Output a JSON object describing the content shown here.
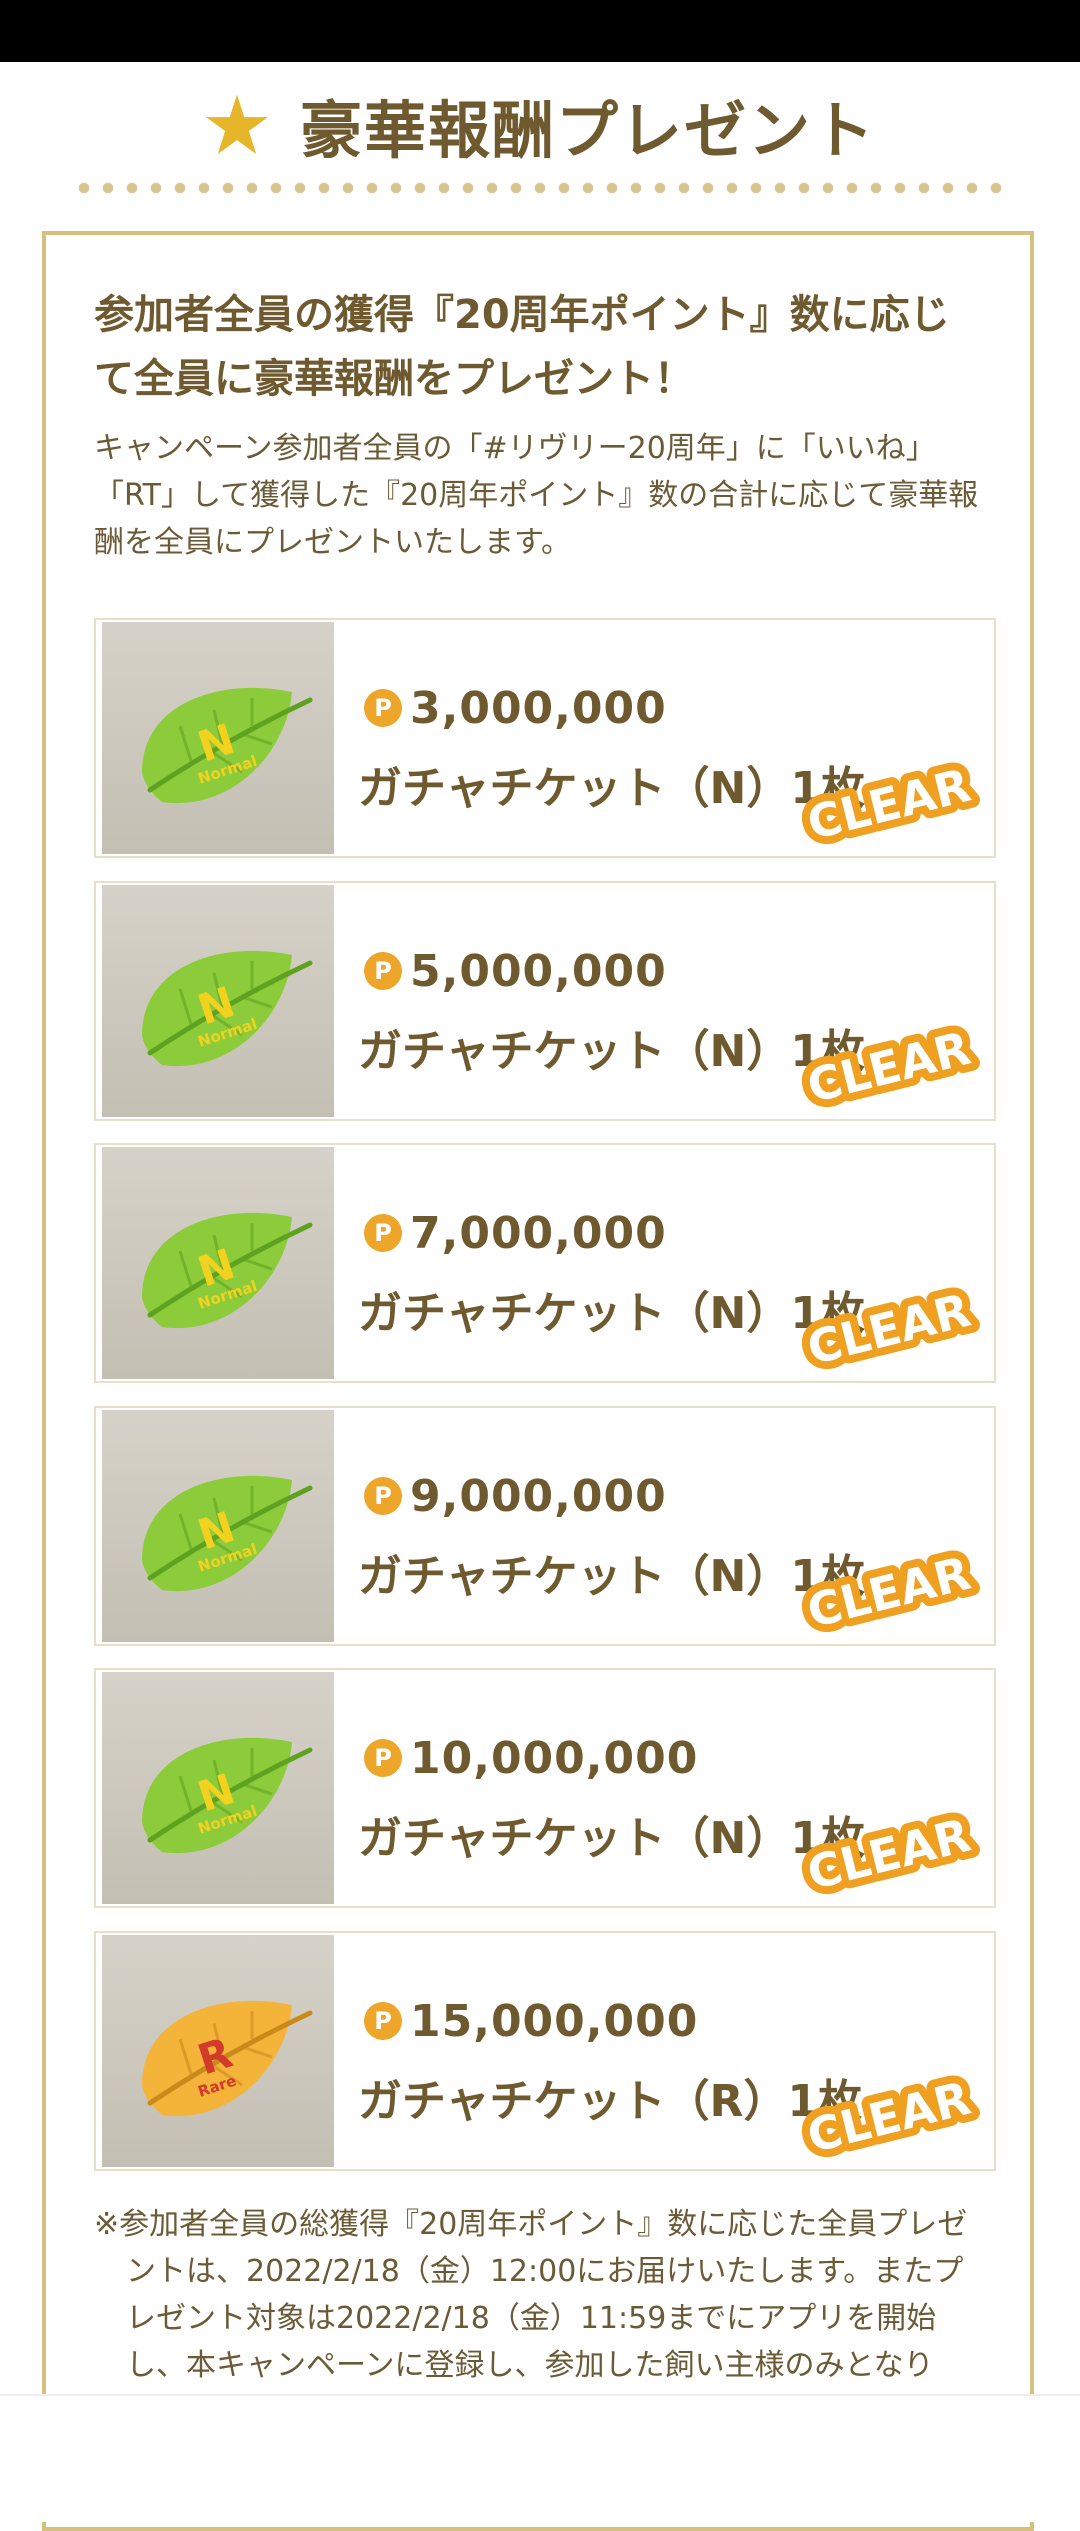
{
  "header": {
    "title": "豪華報酬プレゼント",
    "star_color": "#e6b52a"
  },
  "panel": {
    "headline": "参加者全員の獲得『20周年ポイント』数に応じて全員に豪華報酬をプレゼント！",
    "description": "キャンペーン参加者全員の「#リヴリー20周年」に「いいね」「RT」して獲得した『20周年ポイント』数の合計に応じて豪華報酬を全員にプレゼントいたします。",
    "rewards": [
      {
        "points": "3,000,000",
        "item": "ガチャチケット（N）1枚",
        "leaf_letter": "N",
        "leaf_label": "Normal",
        "leaf_color": "#8ccc3a",
        "status": "CLEAR"
      },
      {
        "points": "5,000,000",
        "item": "ガチャチケット（N）1枚",
        "leaf_letter": "N",
        "leaf_label": "Normal",
        "leaf_color": "#8ccc3a",
        "status": "CLEAR"
      },
      {
        "points": "7,000,000",
        "item": "ガチャチケット（N）1枚",
        "leaf_letter": "N",
        "leaf_label": "Normal",
        "leaf_color": "#8ccc3a",
        "status": "CLEAR"
      },
      {
        "points": "9,000,000",
        "item": "ガチャチケット（N）1枚",
        "leaf_letter": "N",
        "leaf_label": "Normal",
        "leaf_color": "#8ccc3a",
        "status": "CLEAR"
      },
      {
        "points": "10,000,000",
        "item": "ガチャチケット（N）1枚",
        "leaf_letter": "N",
        "leaf_label": "Normal",
        "leaf_color": "#8ccc3a",
        "status": "CLEAR"
      },
      {
        "points": "15,000,000",
        "item": "ガチャチケット（R）1枚",
        "leaf_letter": "R",
        "leaf_label": "Rare",
        "leaf_color": "#f4b43a",
        "status": "CLEAR"
      }
    ],
    "coin_symbol": "P",
    "note": "※参加者全員の総獲得『20周年ポイント』数に応じた全員プレゼントは、2022/2/18（金）12:00にお届けいたします。またプレゼント対象は2022/2/18（金）11:59までにアプリを開始し、本キャンペーンに登録し、参加した飼い主様のみとなり"
  }
}
